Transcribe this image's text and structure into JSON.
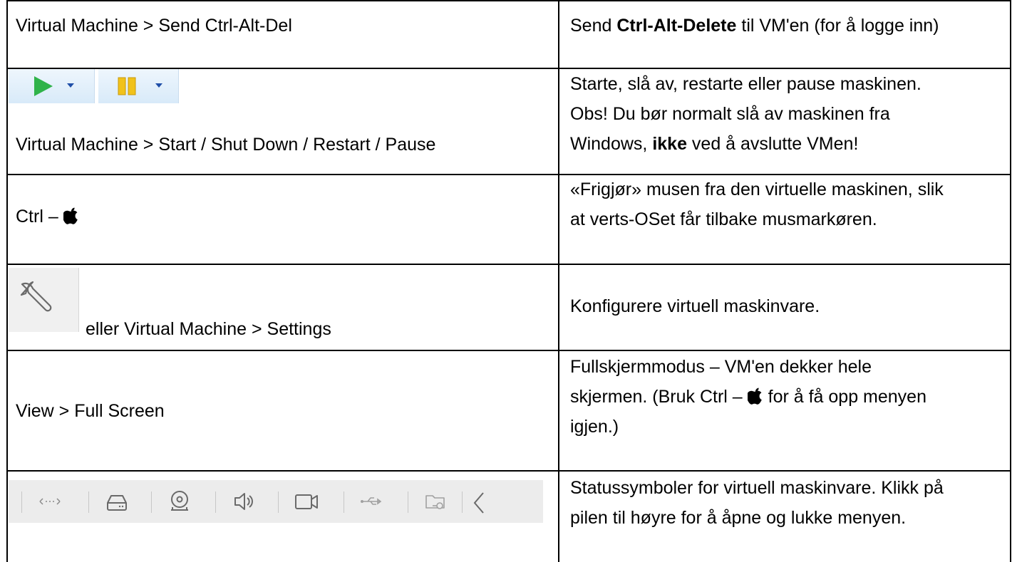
{
  "rows": [
    {
      "left": "Virtual Machine > Send Ctrl-Alt-Del",
      "right": {
        "before": "Send ",
        "bold": "Ctrl-Alt-Delete",
        "after": " til VM'en (for å logge inn)"
      }
    },
    {
      "left": "Virtual Machine > Start / Shut Down / Restart / Pause",
      "right_lines": [
        "Starte, slå av, restarte eller pause maskinen.",
        "Obs! Du bør normalt slå av maskinen fra"
      ],
      "right_line3": {
        "before": "Windows, ",
        "bold": "ikke",
        "after": " ved å avslutte VMen!"
      },
      "icons": [
        "play-icon",
        "pause-icon"
      ]
    },
    {
      "left": "Ctrl – ",
      "left_icon": "apple-icon",
      "right_lines": [
        "«Frigjør» musen fra den virtuelle maskinen, slik",
        "at verts-OSet får tilbake musmarkøren."
      ]
    },
    {
      "left": "eller Virtual Machine > Settings",
      "left_icon": "wrench-icon",
      "right": "Konfigurere virtuell maskinvare."
    },
    {
      "left": "View > Full Screen",
      "right_lines": [
        "Fullskjermmodus – VM'en dekker hele"
      ],
      "right_line2": {
        "before": "skjermen. (Bruk Ctrl – ",
        "icon": "apple-icon",
        "after": " for å få opp menyen"
      },
      "right_line3": "igjen.)"
    },
    {
      "status_icons": [
        "network-icon",
        "hard-disk-icon",
        "cd-dvd-icon",
        "sound-icon",
        "camera-icon",
        "usb-icon",
        "shared-folder-icon",
        "collapse-arrow-icon"
      ],
      "right_lines": [
        "Statussymboler for virtuell maskinvare. Klikk på",
        "pilen til høyre for å åpne og lukke menyen."
      ]
    }
  ],
  "colors": {
    "play_green": "#2fb34a",
    "pause_yellow": "#f1c21b",
    "dropdown_blue": "#1f4fa8",
    "icon_gray": "#8a8a8a"
  }
}
